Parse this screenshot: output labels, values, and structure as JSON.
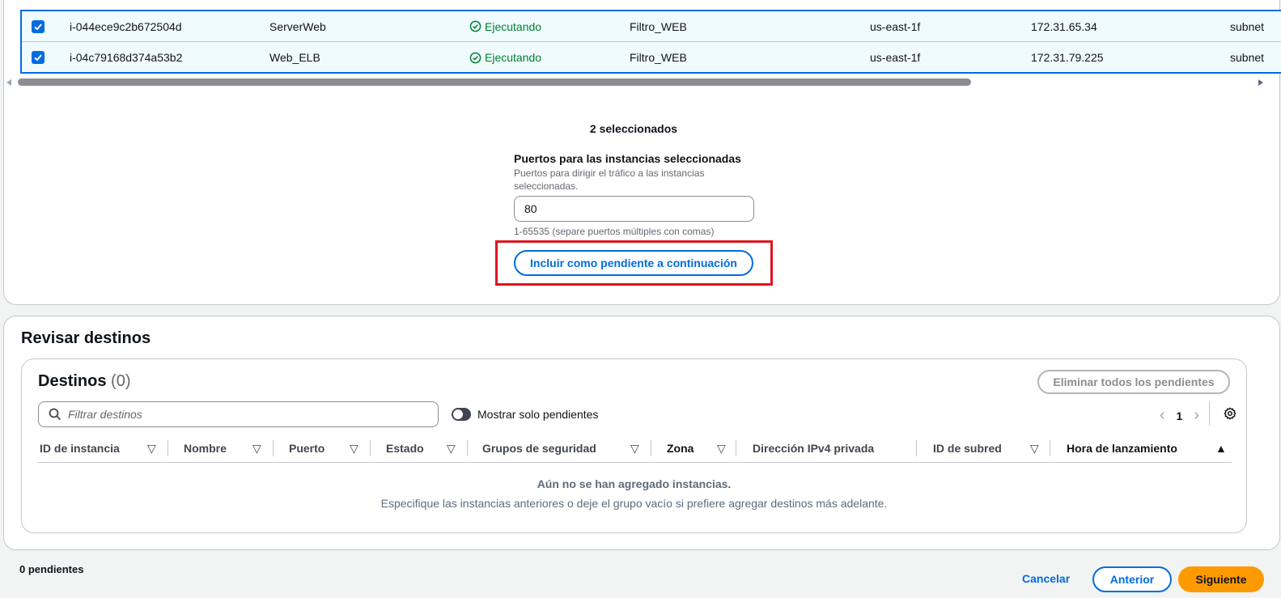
{
  "instances": [
    {
      "id": "i-044ece9c2b672504d",
      "name": "ServerWeb",
      "state": "Ejecutando",
      "security_group": "Filtro_WEB",
      "zone": "us-east-1f",
      "ip": "172.31.65.34",
      "subnet": "subnet"
    },
    {
      "id": "i-04c79168d374a53b2",
      "name": "Web_ELB",
      "state": "Ejecutando",
      "security_group": "Filtro_WEB",
      "zone": "us-east-1f",
      "ip": "172.31.79.225",
      "subnet": "subnet"
    }
  ],
  "selection": {
    "count_text": "2 seleccionados",
    "ports_label": "Puertos para las instancias seleccionadas",
    "ports_description": "Puertos para dirigir el tráfico a las instancias seleccionadas.",
    "ports_value": "80",
    "ports_hint": "1-65535 (separe puertos múltiples con comas)",
    "add_button": "Incluir como pendiente a continuación"
  },
  "review": {
    "title": "Revisar destinos",
    "targets_title": "Destinos",
    "targets_count": "(0)",
    "remove_all": "Eliminar todos los pendientes",
    "filter_placeholder": "Filtrar destinos",
    "toggle_label": "Mostrar solo pendientes",
    "page": "1",
    "columns": [
      "ID de instancia",
      "Nombre",
      "Puerto",
      "Estado",
      "Grupos de seguridad",
      "Zona",
      "Dirección IPv4 privada",
      "ID de subred",
      "Hora de lanzamiento"
    ],
    "empty_title": "Aún no se han agregado instancias.",
    "empty_desc": "Especifique las instancias anteriores o deje el grupo vacío si prefiere agregar destinos más adelante."
  },
  "footer": {
    "pending": "0 pendientes",
    "cancel": "Cancelar",
    "previous": "Anterior",
    "next": "Siguiente"
  },
  "colors": {
    "accent": "#006ce0",
    "running": "#00802f",
    "primary_button": "#ff9900",
    "highlight": "#e0141e"
  }
}
